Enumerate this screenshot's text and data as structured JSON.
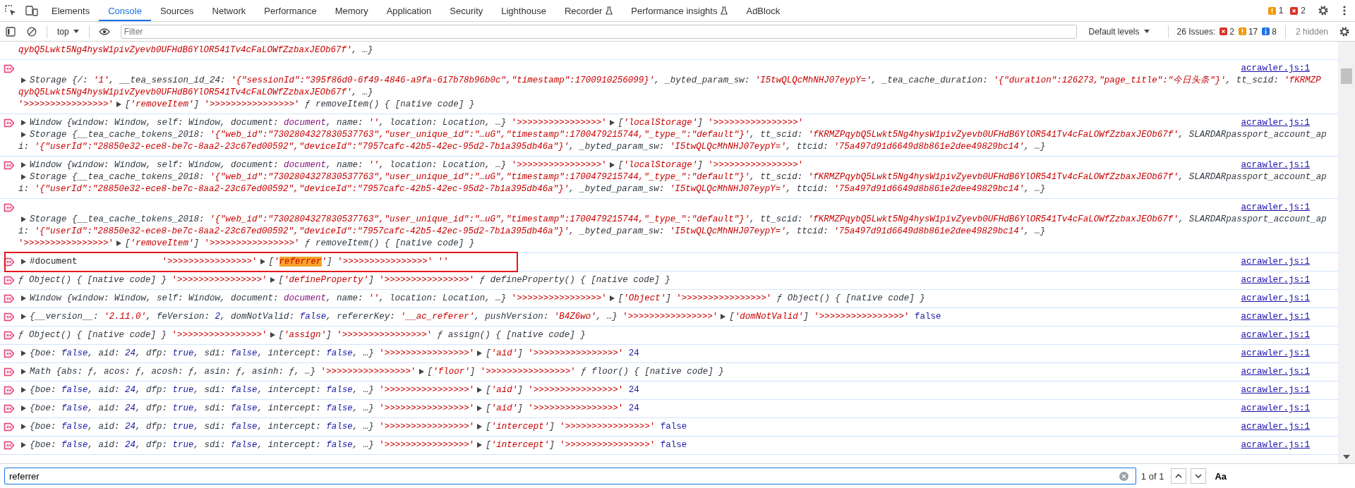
{
  "tabs_bar": {
    "tabs": [
      {
        "label": "Elements",
        "selected": false,
        "experimental": false
      },
      {
        "label": "Console",
        "selected": true,
        "experimental": false
      },
      {
        "label": "Sources",
        "selected": false,
        "experimental": false
      },
      {
        "label": "Network",
        "selected": false,
        "experimental": false
      },
      {
        "label": "Performance",
        "selected": false,
        "experimental": false
      },
      {
        "label": "Memory",
        "selected": false,
        "experimental": false
      },
      {
        "label": "Application",
        "selected": false,
        "experimental": false
      },
      {
        "label": "Security",
        "selected": false,
        "experimental": false
      },
      {
        "label": "Lighthouse",
        "selected": false,
        "experimental": false
      },
      {
        "label": "Recorder",
        "selected": false,
        "experimental": true
      },
      {
        "label": "Performance insights",
        "selected": false,
        "experimental": true
      },
      {
        "label": "AdBlock",
        "selected": false,
        "experimental": false
      }
    ],
    "warnings": "1",
    "errors": "2"
  },
  "console_toolbar": {
    "context": "top",
    "filter_placeholder": "Filter",
    "levels": "Default levels",
    "issues_label": "26 Issues:",
    "issue_counts": [
      {
        "kind": "error",
        "count": "2"
      },
      {
        "kind": "warning",
        "count": "17"
      },
      {
        "kind": "info",
        "count": "8"
      }
    ],
    "hidden": "2 hidden"
  },
  "clipped_message": {
    "lines": [
      [
        {
          "kind": "pstring",
          "text": "qybQ5Lwkt5Ng4hysW1pivZyevb0UFHdB6YlOR541Tv4cFaLOWfZzbaxJEOb67f'"
        },
        {
          "kind": "preview",
          "text": ", …}"
        }
      ]
    ]
  },
  "messages": [
    {
      "source": "acrawler.js:1",
      "annotated": false,
      "lines": [
        [
          {
            "kind": "caret"
          },
          {
            "kind": "preview",
            "text": "Storage {/: "
          },
          {
            "kind": "pstring",
            "text": "'1'"
          },
          {
            "kind": "preview",
            "text": ", __tea_session_id_24: "
          },
          {
            "kind": "pstring",
            "text": "'{\"sessionId\":\"395f86d0-6f49-4846-a9fa-617b78b96b0c\",\"timestamp\":1700910256099}'"
          },
          {
            "kind": "preview",
            "text": ", _byted_param_sw: "
          },
          {
            "kind": "pstring",
            "text": "'I5twQLQcMhNHJ07eypY='"
          },
          {
            "kind": "preview",
            "text": ", _tea_cache_duration: "
          },
          {
            "kind": "pstring",
            "text": "'{\"duration\":126273,\"page_title\":\"今日头条\"}'"
          },
          {
            "kind": "preview",
            "text": ", tt_scid: "
          },
          {
            "kind": "pstring",
            "text": "'fKRMZP"
          }
        ],
        [
          {
            "kind": "pstring",
            "text": "qybQ5Lwkt5Ng4hysW1pivZyevb0UFHdB6YlOR541Tv4cFaLOWfZzbaxJEOb67f'"
          },
          {
            "kind": "preview",
            "text": ", …}"
          }
        ],
        [
          {
            "kind": "string",
            "text": "'>>>>>>>>>>>>>>>>'"
          },
          {
            "kind": "caret"
          },
          {
            "kind": "preview",
            "text": "["
          },
          {
            "kind": "pstring",
            "text": "'removeItem'"
          },
          {
            "kind": "preview",
            "text": "] "
          },
          {
            "kind": "string",
            "text": "'>>>>>>>>>>>>>>>>'"
          },
          {
            "kind": "preview",
            "text": " ƒ removeItem() { [native code] }"
          }
        ]
      ]
    },
    {
      "source": "acrawler.js:1",
      "annotated": false,
      "lines": [
        [
          {
            "kind": "caret"
          },
          {
            "kind": "preview",
            "text": "Window {window: Window, self: Window, document: "
          },
          {
            "kind": "pnode",
            "text": "document"
          },
          {
            "kind": "preview",
            "text": ", name: "
          },
          {
            "kind": "pstring",
            "text": "''"
          },
          {
            "kind": "preview",
            "text": ", location: Location, …} "
          },
          {
            "kind": "string",
            "text": "'>>>>>>>>>>>>>>>>'"
          },
          {
            "kind": "caret"
          },
          {
            "kind": "preview",
            "text": "["
          },
          {
            "kind": "pstring",
            "text": "'localStorage'"
          },
          {
            "kind": "preview",
            "text": "] "
          },
          {
            "kind": "string",
            "text": "'>>>>>>>>>>>>>>>>'"
          }
        ],
        [
          {
            "kind": "caret"
          },
          {
            "kind": "preview",
            "text": "Storage {__tea_cache_tokens_2018: "
          },
          {
            "kind": "pstring",
            "text": "'{\"web_id\":\"7302804327830537763\",\"user_unique_id\":\"…uG\",\"timestamp\":1700479215744,\"_type_\":\"default\"}'"
          },
          {
            "kind": "preview",
            "text": ", tt_scid: "
          },
          {
            "kind": "pstring",
            "text": "'fKRMZPqybQ5Lwkt5Ng4hysW1pivZyevb0UFHdB6YlOR541Tv4cFaLOWfZzbaxJEOb67f'"
          },
          {
            "kind": "preview",
            "text": ", SLARDARpassport_account_ap"
          }
        ],
        [
          {
            "kind": "preview",
            "text": "i: "
          },
          {
            "kind": "pstring",
            "text": "'{\"userId\":\"28850e32-ece8-be7c-8aa2-23c67ed00592\",\"deviceId\":\"7957cafc-42b5-42ec-95d2-7b1a395db46a\"}'"
          },
          {
            "kind": "preview",
            "text": ", _byted_param_sw: "
          },
          {
            "kind": "pstring",
            "text": "'I5twQLQcMhNHJ07eypY='"
          },
          {
            "kind": "preview",
            "text": ", ttcid: "
          },
          {
            "kind": "pstring",
            "text": "'75a497d91d6649d8b861e2dee49829bc14'"
          },
          {
            "kind": "preview",
            "text": ", …}"
          }
        ]
      ]
    },
    {
      "source": "acrawler.js:1",
      "annotated": false,
      "lines": [
        [
          {
            "kind": "caret"
          },
          {
            "kind": "preview",
            "text": "Window {window: Window, self: Window, document: "
          },
          {
            "kind": "pnode",
            "text": "document"
          },
          {
            "kind": "preview",
            "text": ", name: "
          },
          {
            "kind": "pstring",
            "text": "''"
          },
          {
            "kind": "preview",
            "text": ", location: Location, …} "
          },
          {
            "kind": "string",
            "text": "'>>>>>>>>>>>>>>>>'"
          },
          {
            "kind": "caret"
          },
          {
            "kind": "preview",
            "text": "["
          },
          {
            "kind": "pstring",
            "text": "'localStorage'"
          },
          {
            "kind": "preview",
            "text": "] "
          },
          {
            "kind": "string",
            "text": "'>>>>>>>>>>>>>>>>'"
          }
        ],
        [
          {
            "kind": "caret"
          },
          {
            "kind": "preview",
            "text": "Storage {__tea_cache_tokens_2018: "
          },
          {
            "kind": "pstring",
            "text": "'{\"web_id\":\"7302804327830537763\",\"user_unique_id\":\"…uG\",\"timestamp\":1700479215744,\"_type_\":\"default\"}'"
          },
          {
            "kind": "preview",
            "text": ", tt_scid: "
          },
          {
            "kind": "pstring",
            "text": "'fKRMZPqybQ5Lwkt5Ng4hysW1pivZyevb0UFHdB6YlOR541Tv4cFaLOWfZzbaxJEOb67f'"
          },
          {
            "kind": "preview",
            "text": ", SLARDARpassport_account_ap"
          }
        ],
        [
          {
            "kind": "preview",
            "text": "i: "
          },
          {
            "kind": "pstring",
            "text": "'{\"userId\":\"28850e32-ece8-be7c-8aa2-23c67ed00592\",\"deviceId\":\"7957cafc-42b5-42ec-95d2-7b1a395db46a\"}'"
          },
          {
            "kind": "preview",
            "text": ", _byted_param_sw: "
          },
          {
            "kind": "pstring",
            "text": "'I5twQLQcMhNHJ07eypY='"
          },
          {
            "kind": "preview",
            "text": ", ttcid: "
          },
          {
            "kind": "pstring",
            "text": "'75a497d91d6649d8b861e2dee49829bc14'"
          },
          {
            "kind": "preview",
            "text": ", …}"
          }
        ]
      ]
    },
    {
      "source": "acrawler.js:1",
      "annotated": false,
      "lines": [
        [
          {
            "kind": "caret"
          },
          {
            "kind": "preview",
            "text": "Storage {__tea_cache_tokens_2018: "
          },
          {
            "kind": "pstring",
            "text": "'{\"web_id\":\"7302804327830537763\",\"user_unique_id\":\"…uG\",\"timestamp\":1700479215744,\"_type_\":\"default\"}'"
          },
          {
            "kind": "preview",
            "text": ", tt_scid: "
          },
          {
            "kind": "pstring",
            "text": "'fKRMZPqybQ5Lwkt5Ng4hysW1pivZyevb0UFHdB6YlOR541Tv4cFaLOWfZzbaxJEOb67f'"
          },
          {
            "kind": "preview",
            "text": ", SLARDARpassport_account_ap"
          }
        ],
        [
          {
            "kind": "preview",
            "text": "i: "
          },
          {
            "kind": "pstring",
            "text": "'{\"userId\":\"28850e32-ece8-be7c-8aa2-23c67ed00592\",\"deviceId\":\"7957cafc-42b5-42ec-95d2-7b1a395db46a\"}'"
          },
          {
            "kind": "preview",
            "text": ", _byted_param_sw: "
          },
          {
            "kind": "pstring",
            "text": "'I5twQLQcMhNHJ07eypY='"
          },
          {
            "kind": "preview",
            "text": ", ttcid: "
          },
          {
            "kind": "pstring",
            "text": "'75a497d91d6649d8b861e2dee49829bc14'"
          },
          {
            "kind": "preview",
            "text": ", …}"
          }
        ],
        [
          {
            "kind": "string",
            "text": "'>>>>>>>>>>>>>>>>'"
          },
          {
            "kind": "caret"
          },
          {
            "kind": "preview",
            "text": "["
          },
          {
            "kind": "pstring",
            "text": "'removeItem'"
          },
          {
            "kind": "preview",
            "text": "] "
          },
          {
            "kind": "string",
            "text": "'>>>>>>>>>>>>>>>>'"
          },
          {
            "kind": "preview",
            "text": " ƒ removeItem() { [native code] }"
          }
        ]
      ]
    },
    {
      "source": "acrawler.js:1",
      "annotated": true,
      "lines": [
        [
          {
            "kind": "caret"
          },
          {
            "kind": "dom",
            "text": "#document"
          },
          {
            "kind": "string",
            "text": "'>>>>>>>>>>>>>>>>'"
          },
          {
            "kind": "caret"
          },
          {
            "kind": "preview",
            "text": "["
          },
          {
            "kind": "pstring",
            "text": "'"
          },
          {
            "kind": "match",
            "text": "referrer"
          },
          {
            "kind": "pstring",
            "text": "'"
          },
          {
            "kind": "preview",
            "text": "] "
          },
          {
            "kind": "string",
            "text": "'>>>>>>>>>>>>>>>>' ''"
          }
        ]
      ]
    },
    {
      "source": "acrawler.js:1",
      "annotated": false,
      "lines": [
        [
          {
            "kind": "preview",
            "text": "ƒ Object() { [native code] } "
          },
          {
            "kind": "string",
            "text": "'>>>>>>>>>>>>>>>>'"
          },
          {
            "kind": "caret"
          },
          {
            "kind": "preview",
            "text": "["
          },
          {
            "kind": "pstring",
            "text": "'defineProperty'"
          },
          {
            "kind": "preview",
            "text": "] "
          },
          {
            "kind": "string",
            "text": "'>>>>>>>>>>>>>>>>'"
          },
          {
            "kind": "preview",
            "text": " ƒ defineProperty() { [native code] }"
          }
        ]
      ]
    },
    {
      "source": "acrawler.js:1",
      "annotated": false,
      "lines": [
        [
          {
            "kind": "caret"
          },
          {
            "kind": "preview",
            "text": "Window {window: Window, self: Window, document: "
          },
          {
            "kind": "pnode",
            "text": "document"
          },
          {
            "kind": "preview",
            "text": ", name: "
          },
          {
            "kind": "pstring",
            "text": "''"
          },
          {
            "kind": "preview",
            "text": ", location: Location, …} "
          },
          {
            "kind": "string",
            "text": "'>>>>>>>>>>>>>>>>'"
          },
          {
            "kind": "caret"
          },
          {
            "kind": "preview",
            "text": "["
          },
          {
            "kind": "pstring",
            "text": "'Object'"
          },
          {
            "kind": "preview",
            "text": "] "
          },
          {
            "kind": "string",
            "text": "'>>>>>>>>>>>>>>>>'"
          },
          {
            "kind": "preview",
            "text": " ƒ Object() { [native code] }"
          }
        ]
      ]
    },
    {
      "source": "acrawler.js:1",
      "annotated": false,
      "lines": [
        [
          {
            "kind": "caret"
          },
          {
            "kind": "preview",
            "text": "{__version__: "
          },
          {
            "kind": "pstring",
            "text": "'2.11.0'"
          },
          {
            "kind": "preview",
            "text": ", feVersion: "
          },
          {
            "kind": "pvalue",
            "text": "2"
          },
          {
            "kind": "preview",
            "text": ", domNotValid: "
          },
          {
            "kind": "pvalue",
            "text": "false"
          },
          {
            "kind": "preview",
            "text": ", refererKey: "
          },
          {
            "kind": "pstring",
            "text": "'__ac_referer'"
          },
          {
            "kind": "preview",
            "text": ", pushVersion: "
          },
          {
            "kind": "pstring",
            "text": "'B4Z6wo'"
          },
          {
            "kind": "preview",
            "text": ", …} "
          },
          {
            "kind": "string",
            "text": "'>>>>>>>>>>>>>>>>'"
          },
          {
            "kind": "caret"
          },
          {
            "kind": "preview",
            "text": "["
          },
          {
            "kind": "pstring",
            "text": "'domNotValid'"
          },
          {
            "kind": "preview",
            "text": "] "
          },
          {
            "kind": "string",
            "text": "'>>>>>>>>>>>>>>>>' "
          },
          {
            "kind": "value",
            "text": "false"
          }
        ]
      ]
    },
    {
      "source": "acrawler.js:1",
      "annotated": false,
      "lines": [
        [
          {
            "kind": "preview",
            "text": "ƒ Object() { [native code] } "
          },
          {
            "kind": "string",
            "text": "'>>>>>>>>>>>>>>>>'"
          },
          {
            "kind": "caret"
          },
          {
            "kind": "preview",
            "text": "["
          },
          {
            "kind": "pstring",
            "text": "'assign'"
          },
          {
            "kind": "preview",
            "text": "] "
          },
          {
            "kind": "string",
            "text": "'>>>>>>>>>>>>>>>>'"
          },
          {
            "kind": "preview",
            "text": " ƒ assign() { [native code] }"
          }
        ]
      ]
    },
    {
      "source": "acrawler.js:1",
      "annotated": false,
      "lines": [
        [
          {
            "kind": "caret"
          },
          {
            "kind": "preview",
            "text": "{boe: "
          },
          {
            "kind": "pvalue",
            "text": "false"
          },
          {
            "kind": "preview",
            "text": ", aid: "
          },
          {
            "kind": "pvalue",
            "text": "24"
          },
          {
            "kind": "preview",
            "text": ", dfp: "
          },
          {
            "kind": "pvalue",
            "text": "true"
          },
          {
            "kind": "preview",
            "text": ", sdi: "
          },
          {
            "kind": "pvalue",
            "text": "false"
          },
          {
            "kind": "preview",
            "text": ", intercept: "
          },
          {
            "kind": "pvalue",
            "text": "false"
          },
          {
            "kind": "preview",
            "text": ", …} "
          },
          {
            "kind": "string",
            "text": "'>>>>>>>>>>>>>>>>'"
          },
          {
            "kind": "caret"
          },
          {
            "kind": "preview",
            "text": "["
          },
          {
            "kind": "pstring",
            "text": "'aid'"
          },
          {
            "kind": "preview",
            "text": "] "
          },
          {
            "kind": "string",
            "text": "'>>>>>>>>>>>>>>>>' "
          },
          {
            "kind": "value",
            "text": "24"
          }
        ]
      ]
    },
    {
      "source": "acrawler.js:1",
      "annotated": false,
      "lines": [
        [
          {
            "kind": "caret"
          },
          {
            "kind": "preview",
            "text": "Math {abs: ƒ, acos: ƒ, acosh: ƒ, asin: ƒ, asinh: ƒ, …} "
          },
          {
            "kind": "string",
            "text": "'>>>>>>>>>>>>>>>>'"
          },
          {
            "kind": "caret"
          },
          {
            "kind": "preview",
            "text": "["
          },
          {
            "kind": "pstring",
            "text": "'floor'"
          },
          {
            "kind": "preview",
            "text": "] "
          },
          {
            "kind": "string",
            "text": "'>>>>>>>>>>>>>>>>'"
          },
          {
            "kind": "preview",
            "text": " ƒ floor() { [native code] }"
          }
        ]
      ]
    },
    {
      "source": "acrawler.js:1",
      "annotated": false,
      "lines": [
        [
          {
            "kind": "caret"
          },
          {
            "kind": "preview",
            "text": "{boe: "
          },
          {
            "kind": "pvalue",
            "text": "false"
          },
          {
            "kind": "preview",
            "text": ", aid: "
          },
          {
            "kind": "pvalue",
            "text": "24"
          },
          {
            "kind": "preview",
            "text": ", dfp: "
          },
          {
            "kind": "pvalue",
            "text": "true"
          },
          {
            "kind": "preview",
            "text": ", sdi: "
          },
          {
            "kind": "pvalue",
            "text": "false"
          },
          {
            "kind": "preview",
            "text": ", intercept: "
          },
          {
            "kind": "pvalue",
            "text": "false"
          },
          {
            "kind": "preview",
            "text": ", …} "
          },
          {
            "kind": "string",
            "text": "'>>>>>>>>>>>>>>>>'"
          },
          {
            "kind": "caret"
          },
          {
            "kind": "preview",
            "text": "["
          },
          {
            "kind": "pstring",
            "text": "'aid'"
          },
          {
            "kind": "preview",
            "text": "] "
          },
          {
            "kind": "string",
            "text": "'>>>>>>>>>>>>>>>>' "
          },
          {
            "kind": "value",
            "text": "24"
          }
        ]
      ]
    },
    {
      "source": "acrawler.js:1",
      "annotated": false,
      "lines": [
        [
          {
            "kind": "caret"
          },
          {
            "kind": "preview",
            "text": "{boe: "
          },
          {
            "kind": "pvalue",
            "text": "false"
          },
          {
            "kind": "preview",
            "text": ", aid: "
          },
          {
            "kind": "pvalue",
            "text": "24"
          },
          {
            "kind": "preview",
            "text": ", dfp: "
          },
          {
            "kind": "pvalue",
            "text": "true"
          },
          {
            "kind": "preview",
            "text": ", sdi: "
          },
          {
            "kind": "pvalue",
            "text": "false"
          },
          {
            "kind": "preview",
            "text": ", intercept: "
          },
          {
            "kind": "pvalue",
            "text": "false"
          },
          {
            "kind": "preview",
            "text": ", …} "
          },
          {
            "kind": "string",
            "text": "'>>>>>>>>>>>>>>>>'"
          },
          {
            "kind": "caret"
          },
          {
            "kind": "preview",
            "text": "["
          },
          {
            "kind": "pstring",
            "text": "'aid'"
          },
          {
            "kind": "preview",
            "text": "] "
          },
          {
            "kind": "string",
            "text": "'>>>>>>>>>>>>>>>>' "
          },
          {
            "kind": "value",
            "text": "24"
          }
        ]
      ]
    },
    {
      "source": "acrawler.js:1",
      "annotated": false,
      "lines": [
        [
          {
            "kind": "caret"
          },
          {
            "kind": "preview",
            "text": "{boe: "
          },
          {
            "kind": "pvalue",
            "text": "false"
          },
          {
            "kind": "preview",
            "text": ", aid: "
          },
          {
            "kind": "pvalue",
            "text": "24"
          },
          {
            "kind": "preview",
            "text": ", dfp: "
          },
          {
            "kind": "pvalue",
            "text": "true"
          },
          {
            "kind": "preview",
            "text": ", sdi: "
          },
          {
            "kind": "pvalue",
            "text": "false"
          },
          {
            "kind": "preview",
            "text": ", intercept: "
          },
          {
            "kind": "pvalue",
            "text": "false"
          },
          {
            "kind": "preview",
            "text": ", …} "
          },
          {
            "kind": "string",
            "text": "'>>>>>>>>>>>>>>>>'"
          },
          {
            "kind": "caret"
          },
          {
            "kind": "preview",
            "text": "["
          },
          {
            "kind": "pstring",
            "text": "'intercept'"
          },
          {
            "kind": "preview",
            "text": "] "
          },
          {
            "kind": "string",
            "text": "'>>>>>>>>>>>>>>>>' "
          },
          {
            "kind": "value",
            "text": "false"
          }
        ]
      ]
    },
    {
      "source": "acrawler.js:1",
      "annotated": false,
      "lines": [
        [
          {
            "kind": "caret"
          },
          {
            "kind": "preview",
            "text": "{boe: "
          },
          {
            "kind": "pvalue",
            "text": "false"
          },
          {
            "kind": "preview",
            "text": ", aid: "
          },
          {
            "kind": "pvalue",
            "text": "24"
          },
          {
            "kind": "preview",
            "text": ", dfp: "
          },
          {
            "kind": "pvalue",
            "text": "true"
          },
          {
            "kind": "preview",
            "text": ", sdi: "
          },
          {
            "kind": "pvalue",
            "text": "false"
          },
          {
            "kind": "preview",
            "text": ", intercept: "
          },
          {
            "kind": "pvalue",
            "text": "false"
          },
          {
            "kind": "preview",
            "text": ", …} "
          },
          {
            "kind": "string",
            "text": "'>>>>>>>>>>>>>>>>'"
          },
          {
            "kind": "caret"
          },
          {
            "kind": "preview",
            "text": "["
          },
          {
            "kind": "pstring",
            "text": "'intercept'"
          },
          {
            "kind": "preview",
            "text": "] "
          },
          {
            "kind": "string",
            "text": "'>>>>>>>>>>>>>>>>' "
          },
          {
            "kind": "value",
            "text": "false"
          }
        ]
      ]
    }
  ],
  "search_bar": {
    "value": "referrer",
    "match_count": "1 of 1",
    "case_toggle": "Aa"
  }
}
